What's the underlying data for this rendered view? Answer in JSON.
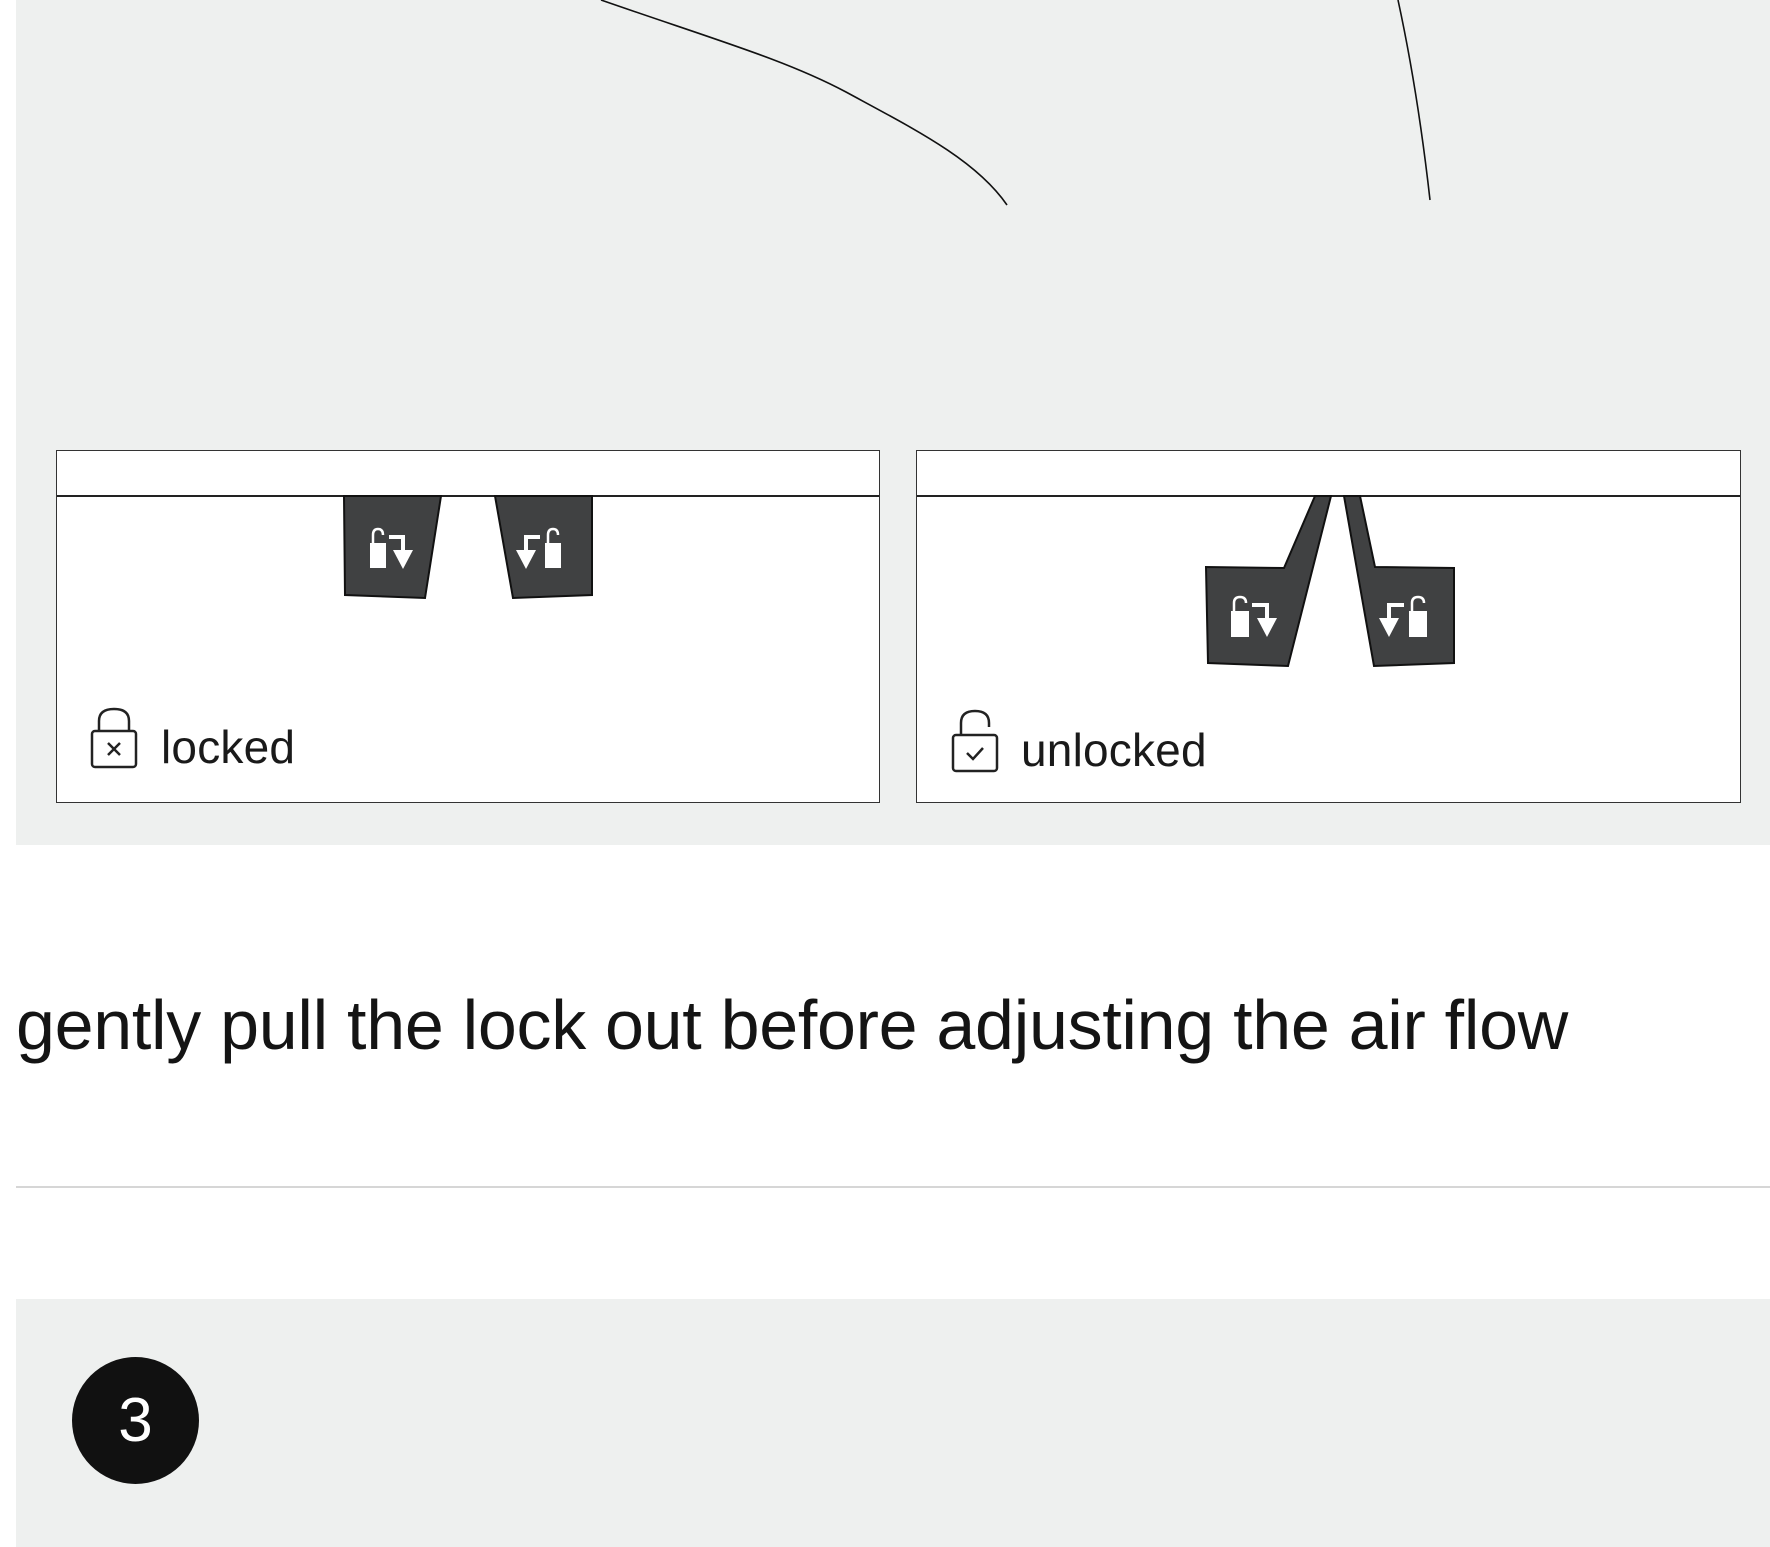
{
  "illustration": {
    "states": [
      {
        "id": "locked",
        "label": "locked",
        "icon": "lock-closed-x-icon"
      },
      {
        "id": "unlocked",
        "label": "unlocked",
        "icon": "lock-open-check-icon"
      }
    ],
    "tab_icon": "unlock-arrow-icon"
  },
  "instruction_text": "gently pull the lock out before adjusting the air flow",
  "step": {
    "number": "3"
  },
  "colors": {
    "panel_bg": "#eef0ef",
    "tab_fill": "#404142",
    "badge_bg": "#111111"
  }
}
